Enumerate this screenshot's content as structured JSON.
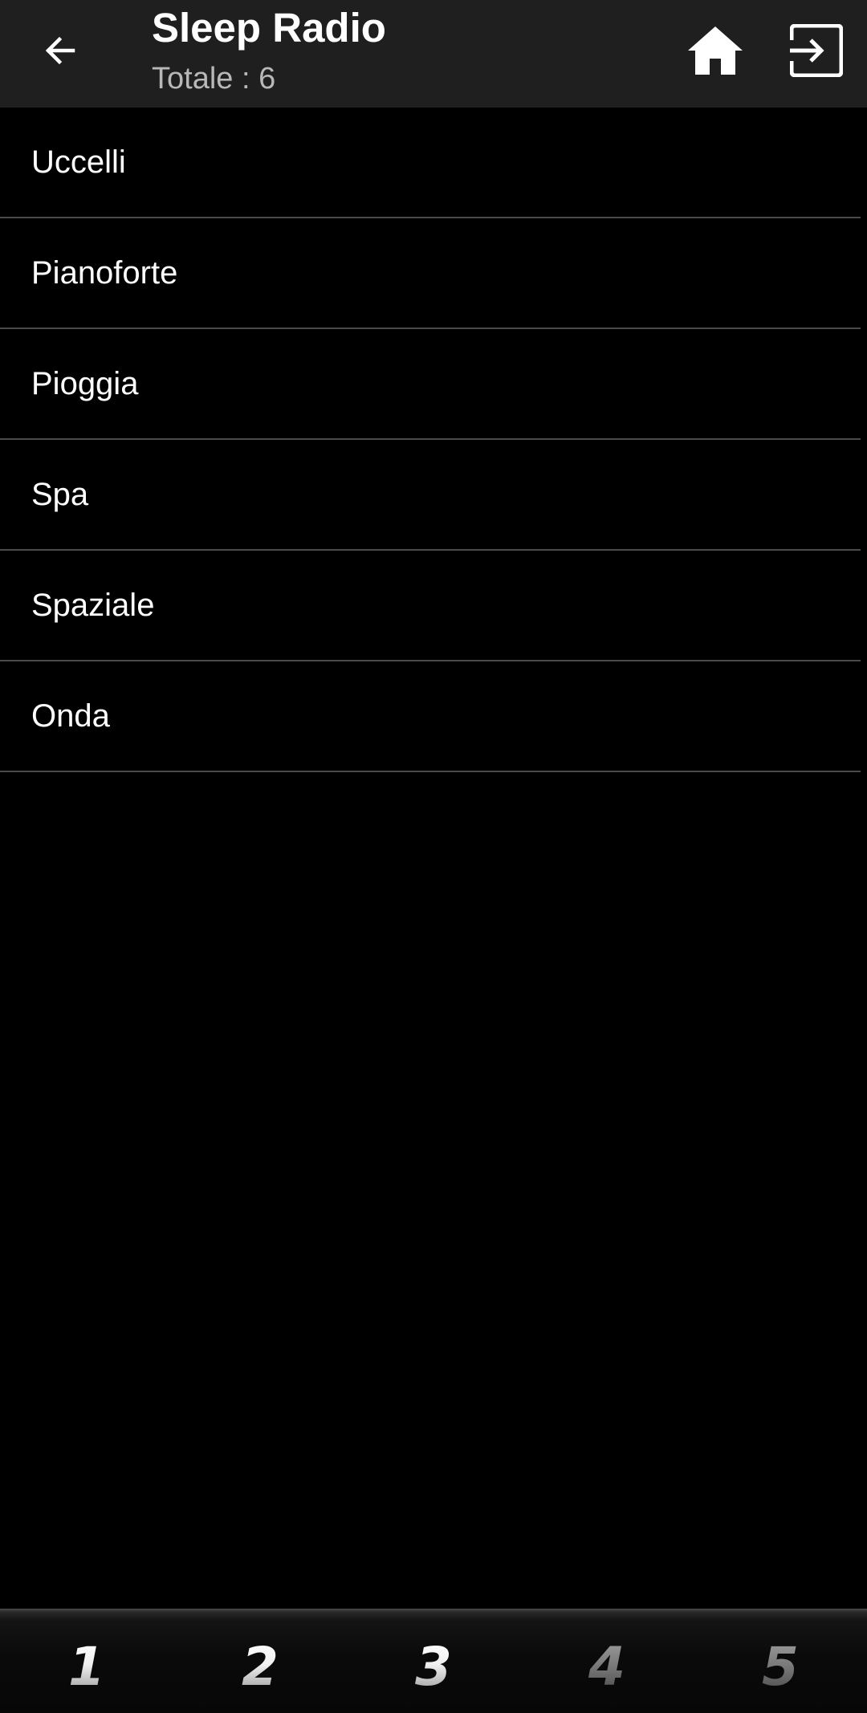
{
  "header": {
    "title": "Sleep Radio",
    "subtitle": "Totale : 6",
    "back_icon": "arrow-left-icon",
    "home_icon": "home-icon",
    "exit_icon": "exit-icon"
  },
  "list": {
    "items": [
      {
        "label": "Uccelli"
      },
      {
        "label": "Pianoforte"
      },
      {
        "label": "Pioggia"
      },
      {
        "label": "Spa"
      },
      {
        "label": "Spaziale"
      },
      {
        "label": "Onda"
      }
    ]
  },
  "bottom_tabs": [
    {
      "label": "1",
      "state": "active"
    },
    {
      "label": "2",
      "state": "active"
    },
    {
      "label": "3",
      "state": "active"
    },
    {
      "label": "4",
      "state": "inactive"
    },
    {
      "label": "5",
      "state": "inactive"
    }
  ],
  "colors": {
    "background": "#000000",
    "topbar": "#1f1f1f",
    "text": "#ffffff",
    "subtitle": "#b8b8b8",
    "divider": "#4a4a4a"
  }
}
